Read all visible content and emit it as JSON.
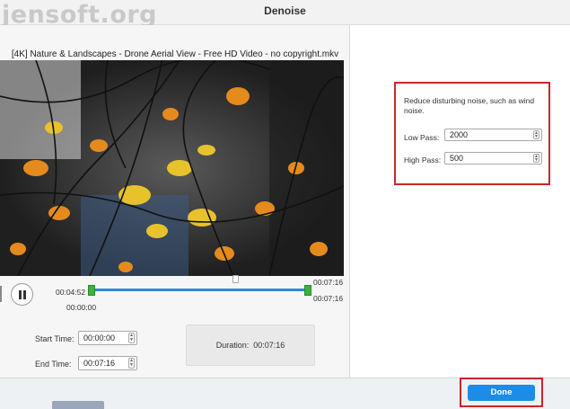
{
  "window": {
    "title": "Denoise",
    "watermark": "jensoft.org"
  },
  "video": {
    "file_name": "[4K] Nature & Landscapes - Drone Aerial View - Free HD Video - no copyright.mkv"
  },
  "playback": {
    "current_time": "00:04:52",
    "start_marker_time": "00:00:00",
    "end_marker_time_top": "00:07:16",
    "end_marker_time_bottom": "00:07:16",
    "playhead_fraction": 0.66
  },
  "trim": {
    "start_label": "Start Time:",
    "start_value": "00:00:00",
    "end_label": "End Time:",
    "end_value": "00:07:16",
    "duration_label": "Duration:",
    "duration_value": "00:07:16"
  },
  "denoise": {
    "description": "Reduce disturbing noise, such as wind noise.",
    "low_pass_label": "Low Pass:",
    "low_pass_value": "2000",
    "high_pass_label": "High Pass:",
    "high_pass_value": "500"
  },
  "footer": {
    "done_label": "Done"
  },
  "colors": {
    "accent_blue": "#1c8ce8",
    "timeline_blue": "#2a8bdc",
    "handle_green": "#3cb23c",
    "highlight_red": "#c8262b"
  }
}
